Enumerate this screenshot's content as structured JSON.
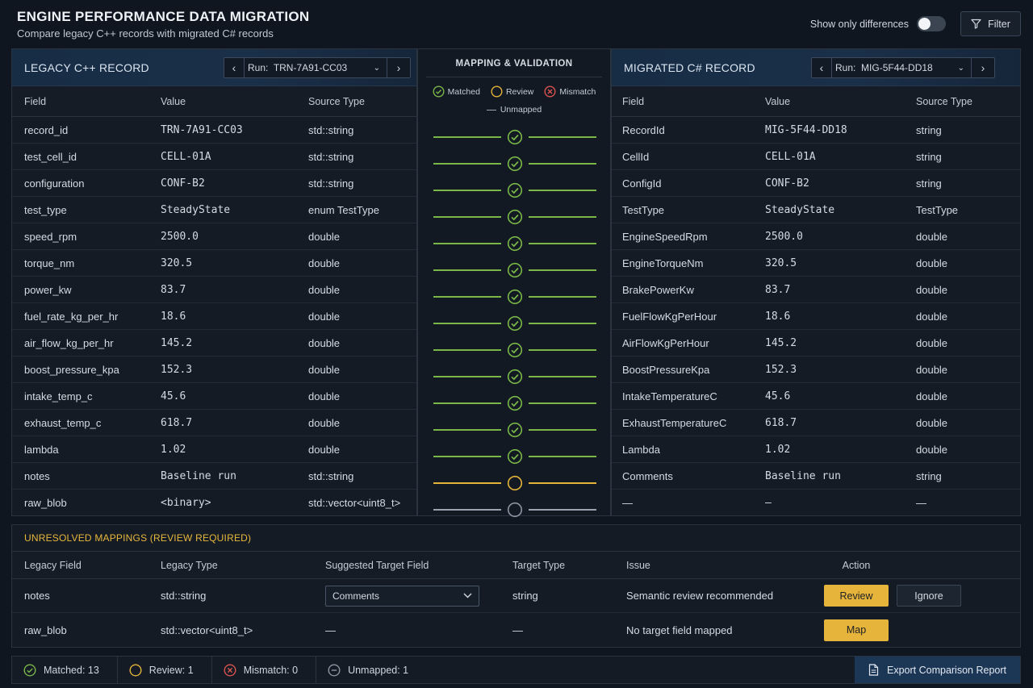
{
  "header": {
    "title": "ENGINE PERFORMANCE DATA MIGRATION",
    "subtitle": "Compare legacy C++ records with migrated C# records",
    "diff_toggle_label": "Show only differences",
    "diff_toggle_on": false,
    "filter_label": "Filter"
  },
  "legacy": {
    "title": "LEGACY C++ RECORD",
    "run_prefix": "Run:",
    "run_value": "TRN-7A91-CC03",
    "columns": [
      "Field",
      "Value",
      "Source Type"
    ],
    "rows": [
      {
        "field": "record_id",
        "value": "TRN-7A91-CC03",
        "type": "std::string"
      },
      {
        "field": "test_cell_id",
        "value": "CELL-01A",
        "type": "std::string"
      },
      {
        "field": "configuration",
        "value": "CONF-B2",
        "type": "std::string"
      },
      {
        "field": "test_type",
        "value": "SteadyState",
        "type": "enum TestType"
      },
      {
        "field": "speed_rpm",
        "value": "2500.0",
        "type": "double"
      },
      {
        "field": "torque_nm",
        "value": "320.5",
        "type": "double"
      },
      {
        "field": "power_kw",
        "value": "83.7",
        "type": "double"
      },
      {
        "field": "fuel_rate_kg_per_hr",
        "value": "18.6",
        "type": "double"
      },
      {
        "field": "air_flow_kg_per_hr",
        "value": "145.2",
        "type": "double"
      },
      {
        "field": "boost_pressure_kpa",
        "value": "152.3",
        "type": "double"
      },
      {
        "field": "intake_temp_c",
        "value": "45.6",
        "type": "double"
      },
      {
        "field": "exhaust_temp_c",
        "value": "618.7",
        "type": "double"
      },
      {
        "field": "lambda",
        "value": "1.02",
        "type": "double"
      },
      {
        "field": "notes",
        "value": "Baseline run",
        "type": "std::string"
      },
      {
        "field": "raw_blob",
        "value": "<binary>",
        "type": "std::vector<uint8_t>"
      }
    ]
  },
  "mapping": {
    "title": "MAPPING & VALIDATION",
    "legend": {
      "matched": "Matched",
      "review": "Review",
      "mismatch": "Mismatch",
      "unmapped": "Unmapped"
    },
    "colors": {
      "matched": "#7ab648",
      "review": "#e3b33a",
      "mismatch": "#d9534f",
      "unmapped": "#8b95a2"
    },
    "statuses": [
      "matched",
      "matched",
      "matched",
      "matched",
      "matched",
      "matched",
      "matched",
      "matched",
      "matched",
      "matched",
      "matched",
      "matched",
      "matched",
      "review",
      "unmapped"
    ]
  },
  "migrated": {
    "title": "MIGRATED C# RECORD",
    "run_prefix": "Run:",
    "run_value": "MIG-5F44-DD18",
    "columns": [
      "Field",
      "Value",
      "Source Type"
    ],
    "rows": [
      {
        "field": "RecordId",
        "value": "MIG-5F44-DD18",
        "type": "string"
      },
      {
        "field": "CellId",
        "value": "CELL-01A",
        "type": "string"
      },
      {
        "field": "ConfigId",
        "value": "CONF-B2",
        "type": "string"
      },
      {
        "field": "TestType",
        "value": "SteadyState",
        "type": "TestType"
      },
      {
        "field": "EngineSpeedRpm",
        "value": "2500.0",
        "type": "double"
      },
      {
        "field": "EngineTorqueNm",
        "value": "320.5",
        "type": "double"
      },
      {
        "field": "BrakePowerKw",
        "value": "83.7",
        "type": "double"
      },
      {
        "field": "FuelFlowKgPerHour",
        "value": "18.6",
        "type": "double"
      },
      {
        "field": "AirFlowKgPerHour",
        "value": "145.2",
        "type": "double"
      },
      {
        "field": "BoostPressureKpa",
        "value": "152.3",
        "type": "double"
      },
      {
        "field": "IntakeTemperatureC",
        "value": "45.6",
        "type": "double"
      },
      {
        "field": "ExhaustTemperatureC",
        "value": "618.7",
        "type": "double"
      },
      {
        "field": "Lambda",
        "value": "1.02",
        "type": "double"
      },
      {
        "field": "Comments",
        "value": "Baseline run",
        "type": "string"
      },
      {
        "field": "—",
        "value": "—",
        "type": "—"
      }
    ]
  },
  "unresolved": {
    "title": "UNRESOLVED MAPPINGS (REVIEW REQUIRED)",
    "columns": [
      "Legacy Field",
      "Legacy Type",
      "Suggested Target Field",
      "Target Type",
      "Issue",
      "Action"
    ],
    "rows": [
      {
        "legacy_field": "notes",
        "legacy_type": "std::string",
        "suggested": "Comments",
        "target_type": "string",
        "issue": "Semantic review recommended",
        "primary_action": "Review",
        "secondary_action": "Ignore"
      },
      {
        "legacy_field": "raw_blob",
        "legacy_type": "std::vector<uint8_t>",
        "suggested": "—",
        "target_type": "—",
        "issue": "No target field mapped",
        "primary_action": "Map"
      }
    ]
  },
  "status_bar": {
    "matched": "Matched: 13",
    "review": "Review: 1",
    "mismatch": "Mismatch: 0",
    "unmapped": "Unmapped: 1",
    "export_label": "Export Comparison Report"
  }
}
